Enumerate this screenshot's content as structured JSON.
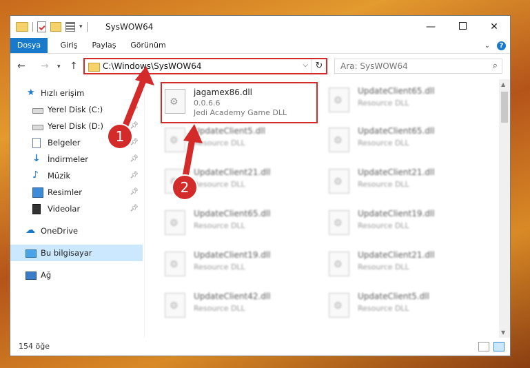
{
  "window": {
    "title": "SysWOW64"
  },
  "ribbon": {
    "tabs": [
      "Dosya",
      "Giriş",
      "Paylaş",
      "Görünüm"
    ],
    "help": "?"
  },
  "nav": {
    "address": "C:\\Windows\\SysWOW64",
    "search_placeholder": "Ara: SysWOW64"
  },
  "sidebar": {
    "items": [
      {
        "label": "Hızlı erişim",
        "icon": "star-icon"
      },
      {
        "label": "Yerel Disk (C:)",
        "icon": "drive-icon",
        "pinned": true
      },
      {
        "label": "Yerel Disk (D:)",
        "icon": "drive-icon",
        "pinned": true
      },
      {
        "label": "Belgeler",
        "icon": "documents-icon",
        "pinned": true
      },
      {
        "label": "İndirmeler",
        "icon": "downloads-icon",
        "pinned": true
      },
      {
        "label": "Müzik",
        "icon": "music-icon",
        "pinned": true
      },
      {
        "label": "Resimler",
        "icon": "pictures-icon",
        "pinned": true
      },
      {
        "label": "Videolar",
        "icon": "videos-icon",
        "pinned": true
      },
      {
        "label": "OneDrive",
        "icon": "cloud-icon"
      },
      {
        "label": "Bu bilgisayar",
        "icon": "computer-icon",
        "selected": true
      },
      {
        "label": "Ağ",
        "icon": "network-icon"
      }
    ]
  },
  "files": {
    "highlighted": {
      "name": "jagamex86.dll",
      "version": "0.0.6.6",
      "description": "Jedi Academy Game DLL"
    },
    "left_column": [
      {
        "name": "UpdateClient5.dll",
        "desc": "Resource DLL"
      },
      {
        "name": "UpdateClient21.dll",
        "desc": "Resource DLL"
      },
      {
        "name": "UpdateClient65.dll",
        "desc": "Resource DLL"
      },
      {
        "name": "UpdateClient19.dll",
        "desc": "Resource DLL"
      },
      {
        "name": "UpdateClient42.dll",
        "desc": "Resource DLL"
      }
    ],
    "right_column": [
      {
        "name": "UpdateClient65.dll",
        "desc": "Resource DLL"
      },
      {
        "name": "UpdateClient65.dll",
        "desc": "Resource DLL"
      },
      {
        "name": "UpdateClient21.dll",
        "desc": "Resource DLL"
      },
      {
        "name": "UpdateClient19.dll",
        "desc": "Resource DLL"
      },
      {
        "name": "UpdateClient21.dll",
        "desc": "Resource DLL"
      },
      {
        "name": "UpdateClient5.dll",
        "desc": "Resource DLL"
      }
    ]
  },
  "status": {
    "count": "154 öğe"
  },
  "annotations": {
    "step1": "1",
    "step2": "2",
    "color": "#d32a2a"
  }
}
